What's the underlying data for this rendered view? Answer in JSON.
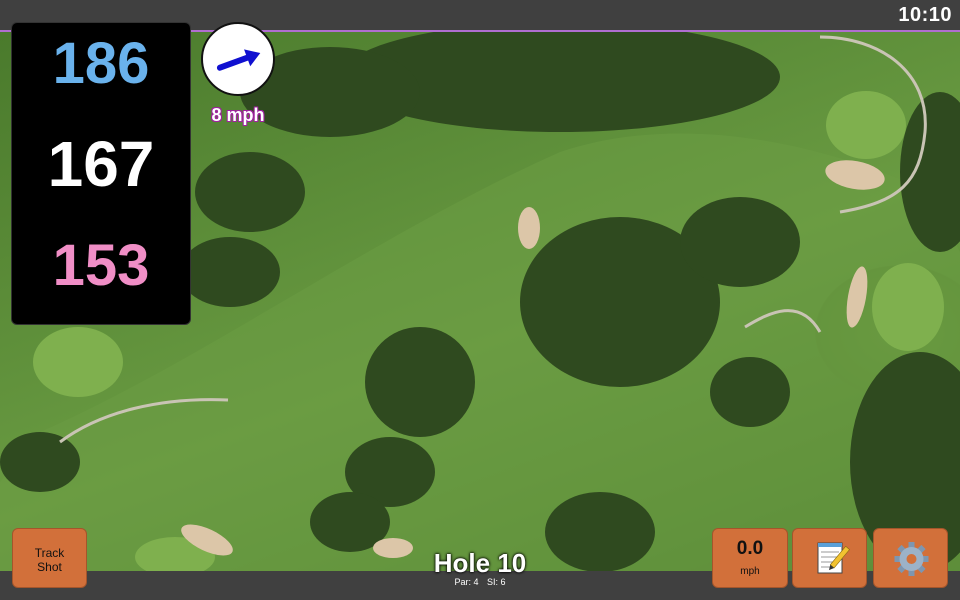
{
  "status": {
    "time": "10:10"
  },
  "distances": {
    "back": "186",
    "middle": "167",
    "front": "153"
  },
  "wind": {
    "speed_label": "8 mph",
    "icon": "wind-arrow-icon"
  },
  "hole": {
    "title": "Hole 10",
    "par_label": "Par: 4",
    "si_label": "SI: 6"
  },
  "buttons": {
    "track_shot_line1": "Track",
    "track_shot_line2": "Shot",
    "speed_value": "0.0",
    "speed_unit": "mph",
    "notes_icon": "notepad-icon",
    "settings_icon": "gear-icon"
  },
  "colors": {
    "back_distance": "#6ab2ec",
    "middle_distance": "#ffffff",
    "front_distance": "#f08ec6",
    "button_bg": "#d2703a"
  }
}
